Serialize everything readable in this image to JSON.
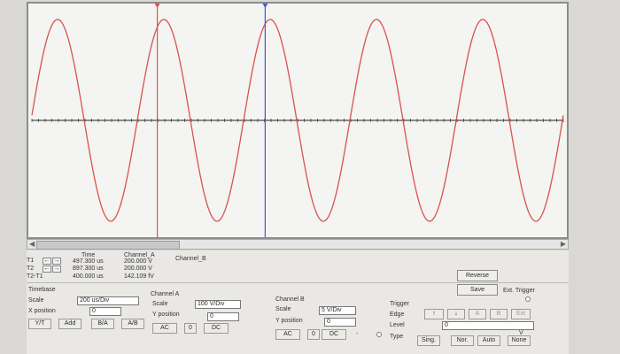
{
  "colors": {
    "signal": "#d9534f",
    "cursor_t1": "#d9534f",
    "cursor_t2": "#3b5bdb",
    "grid": "#c8c8c8",
    "axis": "#222222"
  },
  "readout": {
    "headers": {
      "time": "Time",
      "channel_a": "Channel_A",
      "channel_b": "Channel_B"
    },
    "rows": [
      {
        "label": "T1",
        "time": "497.300 us",
        "channel_a": "200.000 V"
      },
      {
        "label": "T2",
        "time": "897.300 us",
        "channel_a": "200.000 V"
      },
      {
        "label": "T2-T1",
        "time": "400.000 us",
        "channel_a": "142.109 fV"
      }
    ],
    "arrow_left": "←",
    "arrow_right": "→"
  },
  "buttons": {
    "reverse": "Reverse",
    "save": "Save"
  },
  "ext_trigger": {
    "label": "Ext. Trigger"
  },
  "timebase": {
    "title": "Timebase",
    "scale_label": "Scale",
    "scale_value": "200 us/Div",
    "xpos_label": "X position",
    "xpos_value": "0",
    "modes": [
      "Y/T",
      "Add",
      "B/A",
      "A/B"
    ]
  },
  "channel_a": {
    "title": "Channel A",
    "scale_label": "Scale",
    "scale_value": "100 V/Div",
    "ypos_label": "Y position",
    "ypos_value": "0",
    "coupling": [
      "AC",
      "0",
      "DC"
    ]
  },
  "channel_b": {
    "title": "Channel B",
    "scale_label": "Scale",
    "scale_value": "5 V/Div",
    "ypos_label": "Y position",
    "ypos_value": "0",
    "coupling": [
      "AC",
      "0",
      "DC"
    ],
    "extra": "-"
  },
  "trigger": {
    "title": "Trigger",
    "edge_label": "Edge",
    "level_label": "Level",
    "level_value": "0",
    "level_unit": "V",
    "type_label": "Type",
    "edge_buttons": [
      "↑",
      "↓",
      "A",
      "B",
      "Ext"
    ],
    "types": [
      "Sing.",
      "Nor.",
      "Auto",
      "None"
    ]
  },
  "waveform": {
    "cycles_visible": 5,
    "amplitude_fraction": 0.85,
    "t1_fraction": 0.236,
    "t2_fraction": 0.439
  }
}
